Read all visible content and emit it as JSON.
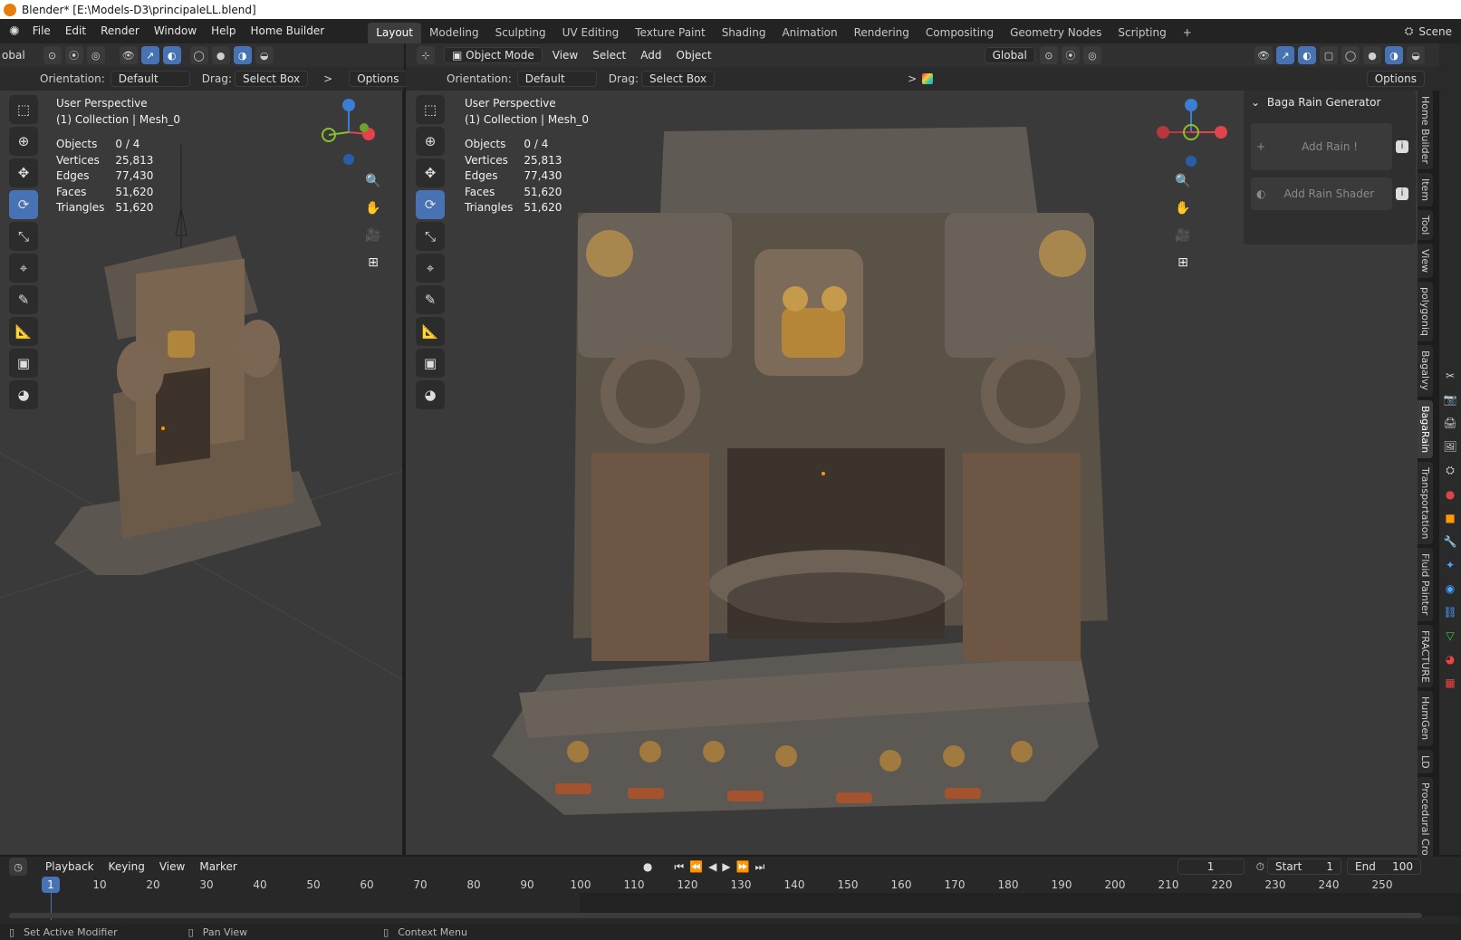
{
  "window": {
    "title": "Blender* [E:\\Models-D3\\principaleLL.blend]"
  },
  "menu": {
    "items": [
      "File",
      "Edit",
      "Render",
      "Window",
      "Help",
      "Home Builder"
    ]
  },
  "workspaces": {
    "tabs": [
      "Layout",
      "Modeling",
      "Sculpting",
      "UV Editing",
      "Texture Paint",
      "Shading",
      "Animation",
      "Rendering",
      "Compositing",
      "Geometry Nodes",
      "Scripting"
    ],
    "active": "Layout",
    "add_symbol": "+"
  },
  "scene": {
    "label": "Scene"
  },
  "left_view": {
    "header": {
      "transform_label": "obal",
      "orientation_label": "Orientation:",
      "orientation_value": "Default",
      "drag_label": "Drag:",
      "drag_value": "Select Box",
      "options_label": "Options",
      "chevron": ">"
    },
    "view_name": "User Perspective",
    "collection": "(1) Collection | Mesh_0",
    "stats": {
      "objects_label": "Objects",
      "objects_value": "0 / 4",
      "vertices_label": "Vertices",
      "vertices_value": "25,813",
      "edges_label": "Edges",
      "edges_value": "77,430",
      "faces_label": "Faces",
      "faces_value": "51,620",
      "triangles_label": "Triangles",
      "triangles_value": "51,620"
    }
  },
  "right_view": {
    "header": {
      "mode": "Object Mode",
      "menus": [
        "View",
        "Select",
        "Add",
        "Object"
      ],
      "transform_value": "Global",
      "orientation_label": "Orientation:",
      "orientation_value": "Default",
      "drag_label": "Drag:",
      "drag_value": "Select Box",
      "options_label": "Options",
      "chevron": ">"
    },
    "view_name": "User Perspective",
    "collection": "(1) Collection | Mesh_0",
    "stats": {
      "objects_label": "Objects",
      "objects_value": "0 / 4",
      "vertices_label": "Vertices",
      "vertices_value": "25,813",
      "edges_label": "Edges",
      "edges_value": "77,430",
      "faces_label": "Faces",
      "faces_value": "51,620",
      "triangles_label": "Triangles",
      "triangles_value": "51,620"
    }
  },
  "gizmo": {
    "x": "X",
    "y": "Y",
    "z": "Z"
  },
  "rain_panel": {
    "title": "Baga Rain Generator",
    "add_rain": "Add Rain !",
    "add_rain_shader": "Add Rain Shader",
    "info_symbol": "i"
  },
  "sidebar_tabs": [
    "Home Builder",
    "Item",
    "Tool",
    "View",
    "polygoniq",
    "Bagalvy",
    "BagaRain",
    "Transportation",
    "Fluid Painter",
    "FRACTURE",
    "HumGen",
    "LD",
    "Procedural Cro"
  ],
  "sidebar_active": "BagaRain",
  "timeline": {
    "menus": [
      "Playback",
      "Keying",
      "View",
      "Marker"
    ],
    "current_frame": "1",
    "start_label": "Start",
    "start_value": "1",
    "end_label": "End",
    "end_value": "100",
    "ticks": [
      "1",
      "10",
      "20",
      "30",
      "40",
      "50",
      "60",
      "70",
      "80",
      "90",
      "100",
      "110",
      "120",
      "130",
      "140",
      "150",
      "160",
      "170",
      "180",
      "190",
      "200",
      "210",
      "220",
      "230",
      "240",
      "250"
    ]
  },
  "status": {
    "left": "Set Active Modifier",
    "middle": "Pan View",
    "right": "Context Menu"
  },
  "colors": {
    "accent": "#4772b3",
    "axis_x": "#e2434c",
    "axis_y": "#8bbf2f",
    "axis_z": "#3b7fd4",
    "playhead": "#4772b3"
  },
  "icons": {
    "tools": [
      "select-box-icon",
      "cursor-icon",
      "move-icon",
      "rotate-icon",
      "scale-icon",
      "transform-icon",
      "annotate-icon",
      "measure-icon",
      "add-cube-icon",
      "shading-icon"
    ]
  }
}
